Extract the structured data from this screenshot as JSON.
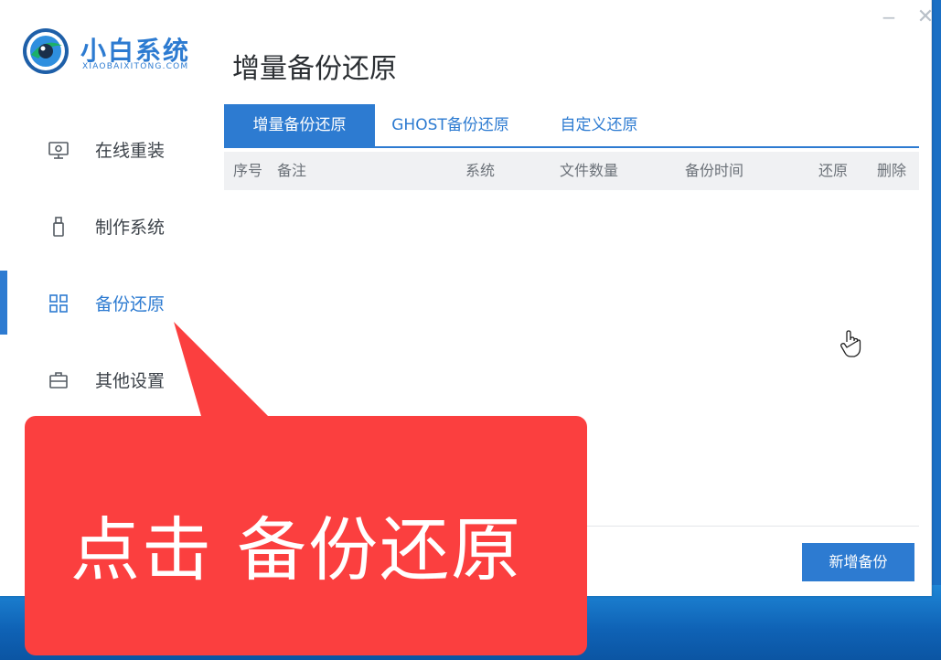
{
  "window": {
    "minimize_glyph": "−",
    "close_glyph": "✕"
  },
  "logo": {
    "title": "小白系统",
    "subtitle": "XIAOBAIXITONG.COM",
    "icon": "xiaobai-logo-icon"
  },
  "sidebar": {
    "items": [
      {
        "label": "在线重装",
        "icon": "monitor-icon"
      },
      {
        "label": "制作系统",
        "icon": "usb-drive-icon"
      },
      {
        "label": "备份还原",
        "icon": "grid-icon",
        "active": true
      },
      {
        "label": "其他设置",
        "icon": "briefcase-icon"
      }
    ]
  },
  "main": {
    "title": "增量备份还原",
    "tabs": [
      {
        "label": "增量备份还原",
        "active": true
      },
      {
        "label": "GHOST备份还原"
      },
      {
        "label": "自定义还原"
      }
    ],
    "table": {
      "columns": [
        "序号",
        "备注",
        "系统",
        "文件数量",
        "备份时间",
        "还原",
        "删除"
      ],
      "rows": []
    },
    "new_backup_label": "新增备份"
  },
  "callout": {
    "text": "点击 备份还原"
  },
  "colors": {
    "accent": "#2d7bd1",
    "callout": "#fb3f3f",
    "header_bg": "#f0f1f3"
  }
}
